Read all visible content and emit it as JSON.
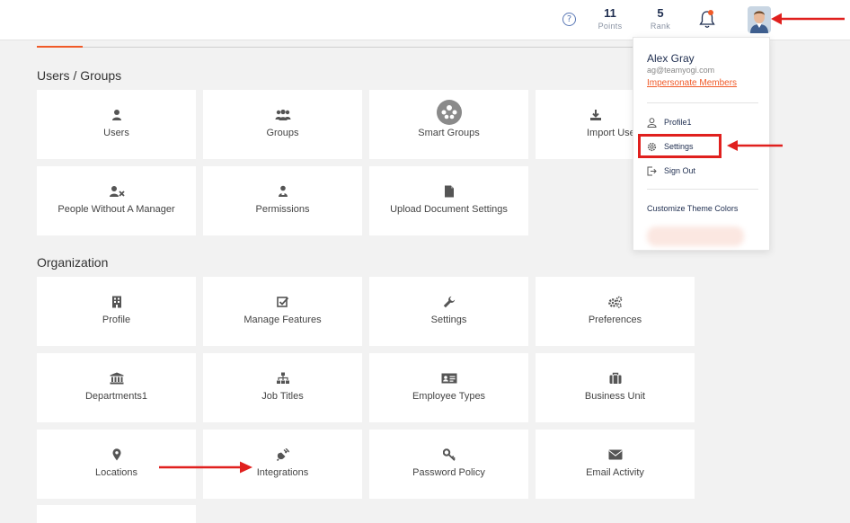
{
  "header": {
    "help_icon": "help-circle-icon",
    "points": {
      "value": "11",
      "label": "Points"
    },
    "rank": {
      "value": "5",
      "label": "Rank"
    },
    "notification_icon": "bell-icon",
    "avatar_icon": "user-avatar"
  },
  "sections": [
    {
      "title": "Users / Groups",
      "tiles": [
        {
          "label": "Users",
          "icon": "user-icon"
        },
        {
          "label": "Groups",
          "icon": "group-icon"
        },
        {
          "label": "Smart Groups",
          "icon": "smart-groups-icon"
        },
        {
          "label": "Import Use",
          "icon": "download-icon"
        },
        {
          "label": "People Without A Manager",
          "icon": "user-x-icon"
        },
        {
          "label": "Permissions",
          "icon": "permissions-icon"
        },
        {
          "label": "Upload Document Settings",
          "icon": "file-icon"
        }
      ]
    },
    {
      "title": "Organization",
      "tiles": [
        {
          "label": "Profile",
          "icon": "building-icon"
        },
        {
          "label": "Manage Features",
          "icon": "checkbox-icon"
        },
        {
          "label": "Settings",
          "icon": "wrench-icon"
        },
        {
          "label": "Preferences",
          "icon": "gears-icon"
        },
        {
          "label": "Departments1",
          "icon": "institution-icon"
        },
        {
          "label": "Job Titles",
          "icon": "sitemap-icon"
        },
        {
          "label": "Employee Types",
          "icon": "id-card-icon"
        },
        {
          "label": "Business Unit",
          "icon": "briefcase-icon"
        },
        {
          "label": "Locations",
          "icon": "map-marker-icon"
        },
        {
          "label": "Integrations",
          "icon": "plug-icon"
        },
        {
          "label": "Password Policy",
          "icon": "key-icon"
        },
        {
          "label": "Email Activity",
          "icon": "envelope-icon"
        }
      ]
    }
  ],
  "user_menu": {
    "name": "Alex Gray",
    "email": "ag@teamyogi.com",
    "impersonate_label": "Impersonate Members",
    "items": [
      {
        "label": "Profile1",
        "icon": "user-outline-icon"
      },
      {
        "label": "Settings",
        "icon": "gear-outline-icon"
      },
      {
        "label": "Sign Out",
        "icon": "sign-out-icon"
      }
    ],
    "theme_label": "Customize Theme Colors"
  },
  "colors": {
    "accent": "#f05a28",
    "annotation_red": "#e0201e",
    "navy": "#1e2d4f",
    "background": "#f2f2f2"
  }
}
